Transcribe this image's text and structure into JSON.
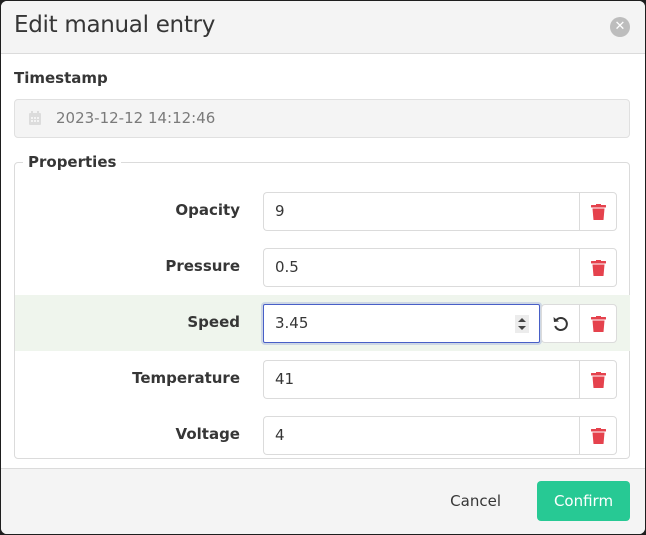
{
  "dialog": {
    "title": "Edit manual entry",
    "close_icon": "close-circle-icon"
  },
  "timestamp": {
    "label": "Timestamp",
    "value": "2023-12-12 14:12:46",
    "icon": "calendar-icon",
    "disabled": true
  },
  "properties": {
    "legend": "Properties",
    "rows": [
      {
        "label": "Opacity",
        "value": "9",
        "modified": false
      },
      {
        "label": "Pressure",
        "value": "0.5",
        "modified": false
      },
      {
        "label": "Speed",
        "value": "3.45",
        "modified": true
      },
      {
        "label": "Temperature",
        "value": "41",
        "modified": false
      },
      {
        "label": "Voltage",
        "value": "4",
        "modified": false
      }
    ]
  },
  "colors": {
    "delete": "#e5424d",
    "confirm": "#27c994",
    "focus": "#485fc7",
    "modified_row": "#eff5ed"
  },
  "footer": {
    "cancel_label": "Cancel",
    "confirm_label": "Confirm"
  }
}
